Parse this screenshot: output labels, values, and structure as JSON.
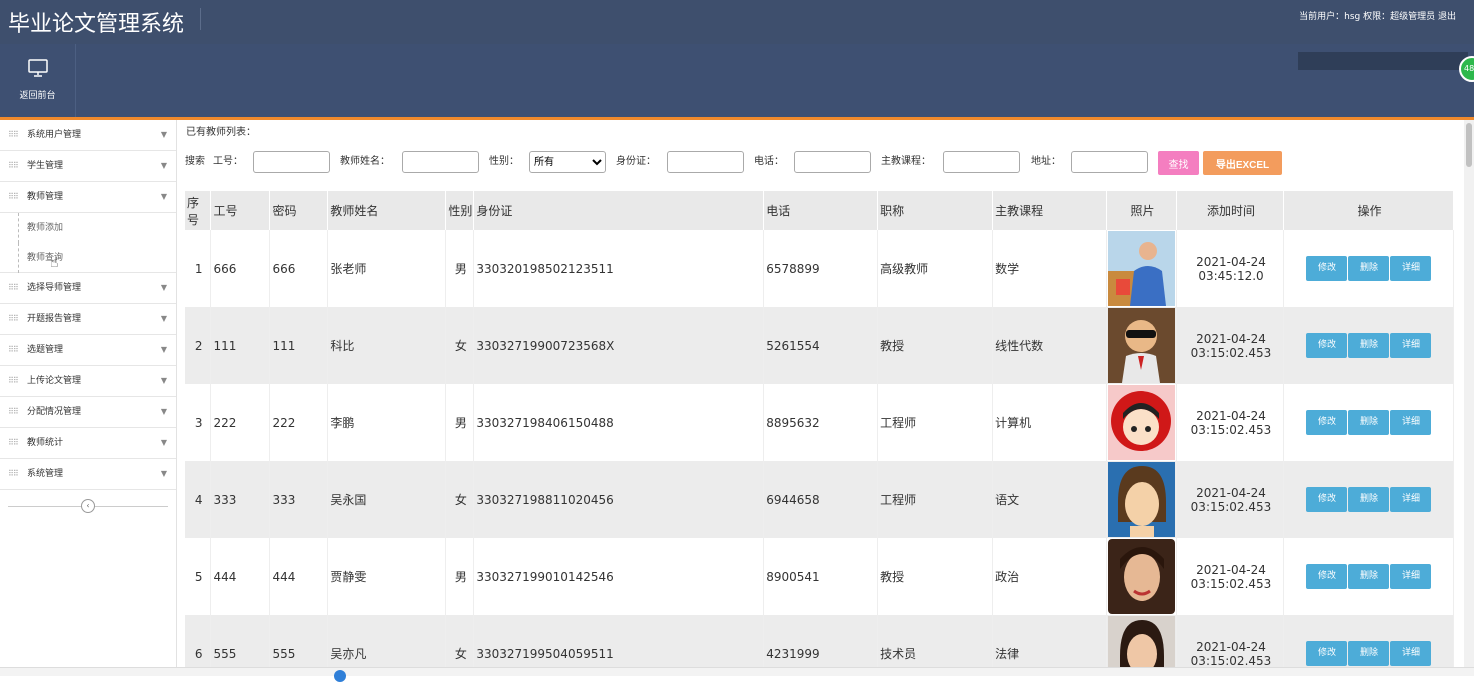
{
  "header": {
    "app_title": "毕业论文管理系统",
    "user_info": "当前用户：hsg  权限：超级管理员  退出"
  },
  "toolbar": {
    "home_label": "返回前台",
    "badge": "48"
  },
  "sidebar": {
    "items": [
      {
        "label": "系统用户管理"
      },
      {
        "label": "学生管理"
      },
      {
        "label": "教师管理"
      },
      {
        "label": "选择导师管理"
      },
      {
        "label": "开题报告管理"
      },
      {
        "label": "选题管理"
      },
      {
        "label": "上传论文管理"
      },
      {
        "label": "分配情况管理"
      },
      {
        "label": "教师统计"
      },
      {
        "label": "系统管理"
      }
    ],
    "sub_items": [
      {
        "label": "教师添加"
      },
      {
        "label": "教师查询"
      }
    ]
  },
  "content": {
    "list_title": "已有教师列表：",
    "search": {
      "prefix": "搜索",
      "label_id": "工号：",
      "label_name": "教师姓名：",
      "label_gender": "性别：",
      "gender_selected": "所有",
      "label_idcard": "身份证：",
      "label_phone": "电话：",
      "label_course": "主教课程：",
      "label_address": "地址：",
      "find_button": "查找",
      "excel_button": "导出EXCEL"
    },
    "table": {
      "headers": [
        "序号",
        "工号",
        "密码",
        "教师姓名",
        "性别",
        "身份证",
        "电话",
        "职称",
        "主教课程",
        "照片",
        "添加时间",
        "操作"
      ],
      "action_labels": {
        "edit": "修改",
        "delete": "删除",
        "detail": "详细"
      },
      "rows": [
        {
          "no": "1",
          "id": "666",
          "pwd": "666",
          "name": "张老师",
          "gender": "男",
          "idcard": "330320198502123511",
          "phone": "6578899",
          "title": "高级教师",
          "course": "数学",
          "date": "2021-04-24",
          "time": "03:45:12.0"
        },
        {
          "no": "2",
          "id": "111",
          "pwd": "111",
          "name": "科比",
          "gender": "女",
          "idcard": "33032719900723568X",
          "phone": "5261554",
          "title": "教授",
          "course": "线性代数",
          "date": "2021-04-24",
          "time": "03:15:02.453"
        },
        {
          "no": "3",
          "id": "222",
          "pwd": "222",
          "name": "李鹏",
          "gender": "男",
          "idcard": "330327198406150488",
          "phone": "8895632",
          "title": "工程师",
          "course": "计算机",
          "date": "2021-04-24",
          "time": "03:15:02.453"
        },
        {
          "no": "4",
          "id": "333",
          "pwd": "333",
          "name": "吴永国",
          "gender": "女",
          "idcard": "330327198811020456",
          "phone": "6944658",
          "title": "工程师",
          "course": "语文",
          "date": "2021-04-24",
          "time": "03:15:02.453"
        },
        {
          "no": "5",
          "id": "444",
          "pwd": "444",
          "name": "贾静雯",
          "gender": "男",
          "idcard": "330327199010142546",
          "phone": "8900541",
          "title": "教授",
          "course": "政治",
          "date": "2021-04-24",
          "time": "03:15:02.453"
        },
        {
          "no": "6",
          "id": "555",
          "pwd": "555",
          "name": "吴亦凡",
          "gender": "女",
          "idcard": "330327199504059511",
          "phone": "4231999",
          "title": "技术员",
          "course": "法律",
          "date": "2021-04-24",
          "time": "03:15:02.453"
        }
      ]
    }
  },
  "colors": {
    "header_bg": "#3e4f6d",
    "accent_orange": "#f08a2c",
    "action_blue": "#4dacd8",
    "find_pink": "#f47ec0",
    "excel_orange": "#f39c5d"
  }
}
